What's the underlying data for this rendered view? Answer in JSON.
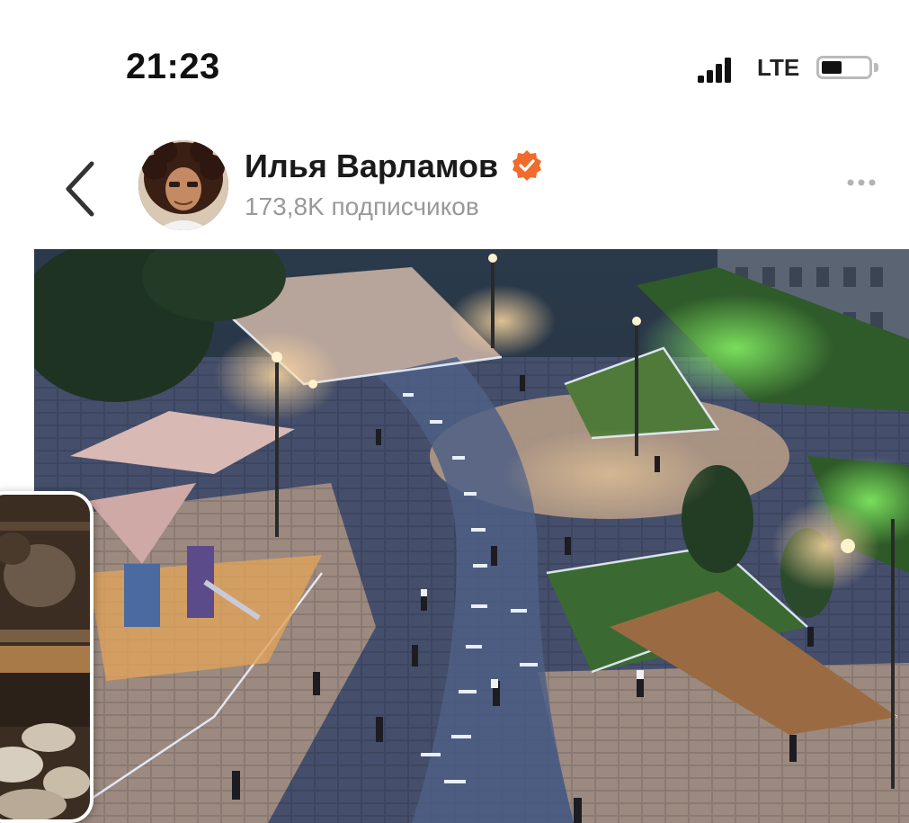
{
  "status_bar": {
    "time": "21:23",
    "network": "LTE",
    "icons": [
      "signal-bars-icon",
      "battery-icon"
    ]
  },
  "channel": {
    "name": "Илья Варламов",
    "subscribers": "173,8K подписчиков",
    "verified": true,
    "verified_color": "#f26a2c"
  },
  "header_icons": {
    "back": "chevron-left-icon",
    "more": "more-horizontal-icon"
  },
  "post": {
    "media": "image",
    "scene": "night-plaza-render"
  },
  "pip": {
    "media": "video-thumbnail"
  },
  "colors": {
    "background": "#ffffff",
    "accent": "#f26a2c",
    "muted_text": "#999999"
  }
}
